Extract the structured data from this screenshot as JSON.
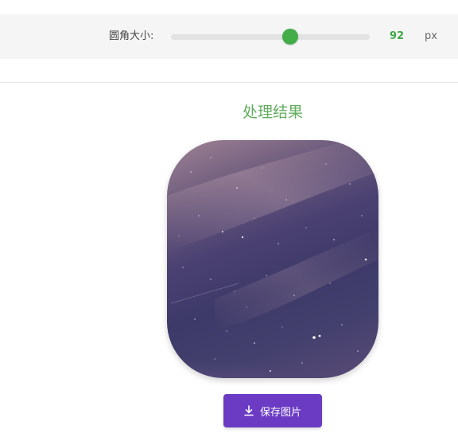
{
  "controls": {
    "radius_label": "圆角大小:",
    "radius_value": "92",
    "radius_unit": "px",
    "slider_level_percent": 60,
    "accent_color": "#43ad4a"
  },
  "result": {
    "title": "处理结果",
    "image_corner_radius": 92,
    "title_color": "#62ad5f"
  },
  "actions": {
    "save_label": "保存图片",
    "save_icon": "download-icon",
    "button_color": "#6b3bc4"
  }
}
